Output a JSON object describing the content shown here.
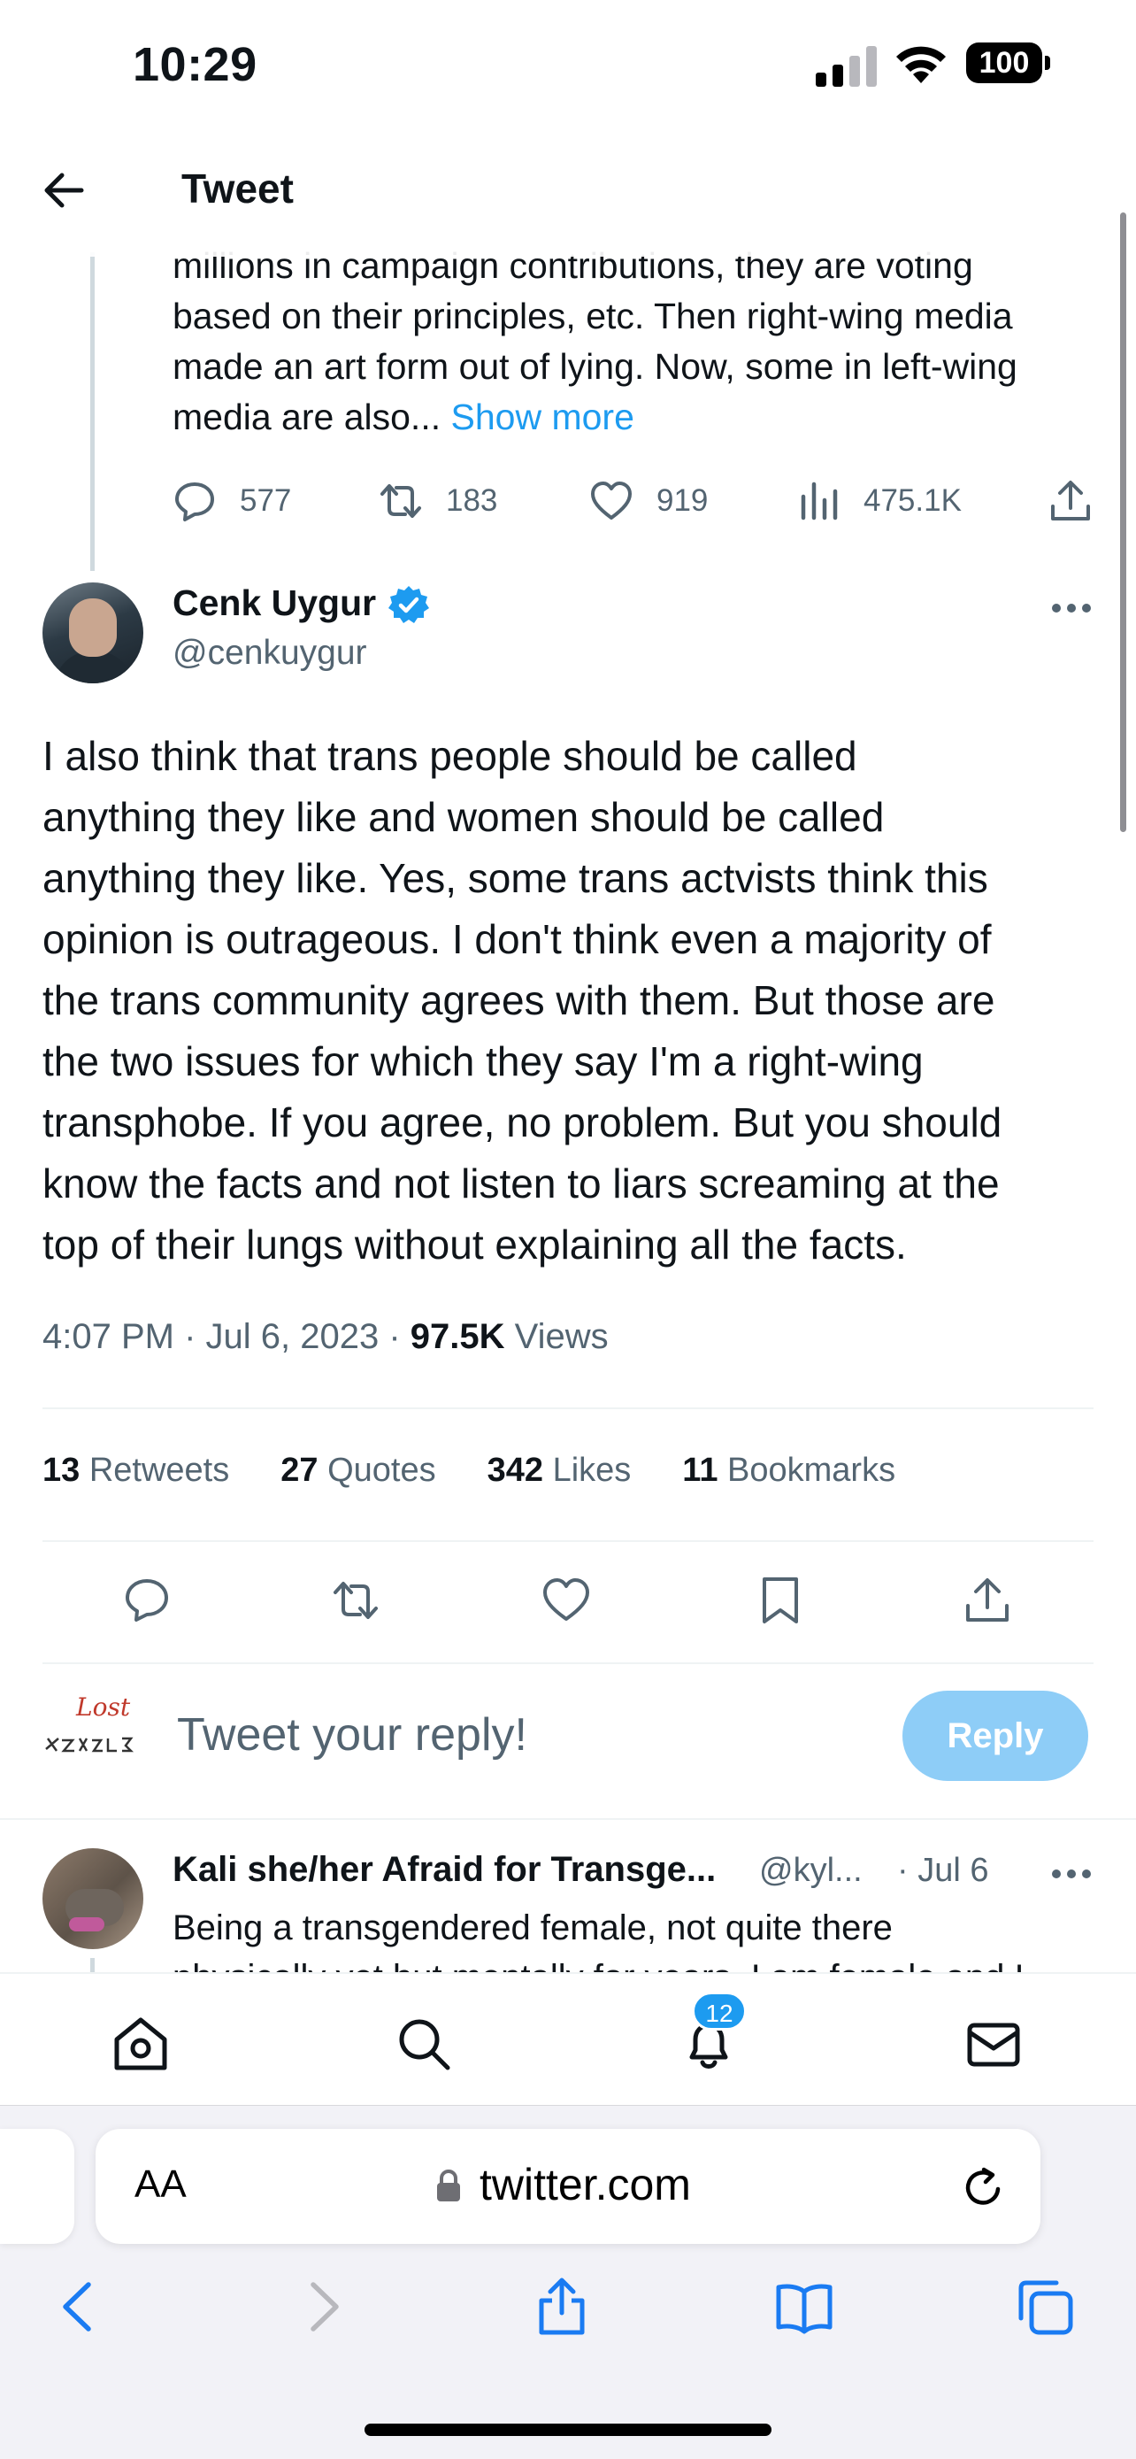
{
  "status_bar": {
    "time": "10:29",
    "battery": "100"
  },
  "header": {
    "title": "Tweet"
  },
  "quoted_tweet": {
    "text_lines": [
      "millions in campaign contributions, they are voting",
      "based on their principles, etc. Then right-wing media",
      "made an art form out of lying. Now, some in left-wing",
      "media are also..."
    ],
    "show_more": "Show more",
    "replies": "577",
    "retweets": "183",
    "likes": "919",
    "views": "475.1K"
  },
  "tweet": {
    "author_name": "Cenk Uygur",
    "author_handle": "@cenkuygur",
    "body_lines": [
      "I also think that trans people should be called",
      "anything they like and women should be called",
      "anything they like. Yes, some trans actvists think this",
      "opinion is outrageous. I don't think even a majority of",
      "the trans community agrees with them. But those are",
      "the two issues for which they say I'm a right-wing",
      "transphobe. If you agree, no problem. But you should",
      "know the facts and not listen to liars screaming at the",
      "top of their lungs without explaining all the facts."
    ],
    "time": "4:07 PM · Jul 6, 2023 · ",
    "views_count": "97.5K",
    "views_label": " Views",
    "stats": {
      "retweets_count": "13",
      "retweets_label": " Retweets",
      "quotes_count": "27",
      "quotes_label": " Quotes",
      "likes_count": "342",
      "likes_label": " Likes",
      "bookmarks_count": "11",
      "bookmarks_label": " Bookmarks"
    }
  },
  "reply_box": {
    "placeholder": "Tweet your reply!",
    "button": "Reply",
    "avatar_text": "Lost"
  },
  "reply": {
    "author": "Kali she/her Afraid for Transge...",
    "handle": "@kyl...",
    "date": "· Jul 6",
    "text_line1": "Being a transgendered female, not quite there",
    "text_line2": "physically yet but mentally for years. I am female and I"
  },
  "nav": {
    "notification_count": "12"
  },
  "browser": {
    "aa": "AA",
    "url": "twitter.com"
  },
  "colors": {
    "accent": "#1d9bf0",
    "reply_button": "#8ecdf7",
    "muted": "#536471",
    "text": "#0f1419"
  }
}
